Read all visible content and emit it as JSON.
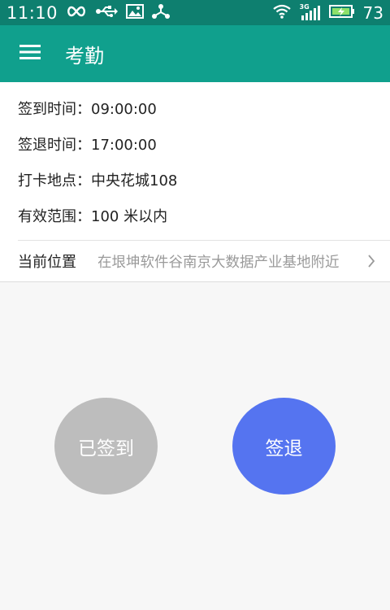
{
  "status_bar": {
    "time": "11:10",
    "battery": "73",
    "network_label": "3G"
  },
  "app_bar": {
    "title": "考勤"
  },
  "info": {
    "sign_in_time": "签到时间：09:00:00",
    "sign_out_time": "签退时间：17:00:00",
    "location": "打卡地点：中央花城108",
    "range": "有效范围：100 米以内"
  },
  "current_location": {
    "label": "当前位置",
    "value": "在垠坤软件谷南京大数据产业基地附近"
  },
  "actions": {
    "signed_in_label": "已签到",
    "sign_out_label": "签退"
  },
  "colors": {
    "status_bar": "#0e7f6f",
    "app_bar": "#10a08d",
    "signed_in_button": "#bdbdbd",
    "sign_out_button": "#5574f0"
  }
}
